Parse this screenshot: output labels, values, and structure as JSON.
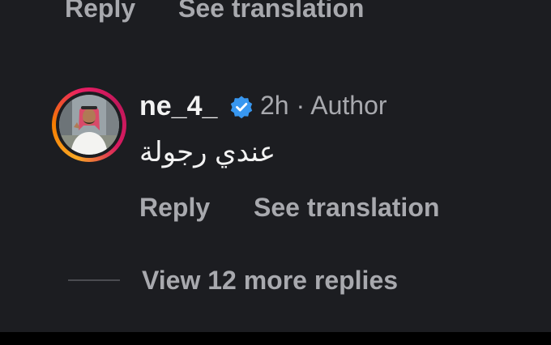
{
  "previous_comment": {
    "reply_label": "Reply",
    "translate_label": "See translation"
  },
  "comment": {
    "username": "ne_4_",
    "verified": true,
    "time": "2h",
    "separator": "·",
    "role": "Author",
    "meta_text": "2h · Author",
    "text": "عندي رجولة",
    "reply_label": "Reply",
    "translate_label": "See translation"
  },
  "replies": {
    "view_more_label": "View 12 more replies"
  },
  "colors": {
    "background": "#1c1d21",
    "primary_text": "#f2f2f2",
    "secondary_text": "#a8a9ae",
    "verified_badge": "#3897f0",
    "story_ring_start": "#f9a825",
    "story_ring_end": "#d81b60"
  },
  "icons": {
    "verified": "verified-badge-icon"
  }
}
